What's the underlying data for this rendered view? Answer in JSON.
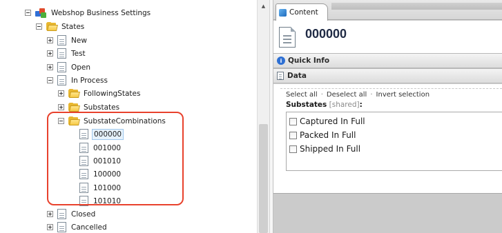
{
  "tree": {
    "root": {
      "label": "Webshop Business Settings"
    },
    "states": {
      "label": "States"
    },
    "items": {
      "new": "New",
      "test": "Test",
      "open": "Open",
      "in_process": "In Process",
      "following_states": "FollowingStates",
      "substates": "Substates",
      "substate_combinations": "SubstateCombinations",
      "combo_000000": "000000",
      "combo_001000": "001000",
      "combo_001010": "001010",
      "combo_100000": "100000",
      "combo_101000": "101000",
      "combo_101010": "101010",
      "closed": "Closed",
      "cancelled": "Cancelled"
    },
    "selected": "000000",
    "highlight_color": "#e8412c"
  },
  "content": {
    "tab_label": "Content",
    "title": "000000",
    "quick_info_label": "Quick Info",
    "data_label": "Data",
    "actions": {
      "select_all": "Select all",
      "deselect_all": "Deselect all",
      "invert_selection": "Invert selection",
      "separator": "·"
    },
    "field": {
      "label": "Substates",
      "shared": "[shared]",
      "colon": ":"
    },
    "checkboxes": [
      {
        "label": "Captured In Full",
        "checked": false
      },
      {
        "label": "Packed In Full",
        "checked": false
      },
      {
        "label": "Shipped In Full",
        "checked": false
      }
    ]
  },
  "icons": {
    "root": "business-settings-icon",
    "folder": "folder-icon",
    "document": "document-icon",
    "info": "info-icon",
    "data": "data-icon",
    "tab": "content-tab-icon"
  }
}
